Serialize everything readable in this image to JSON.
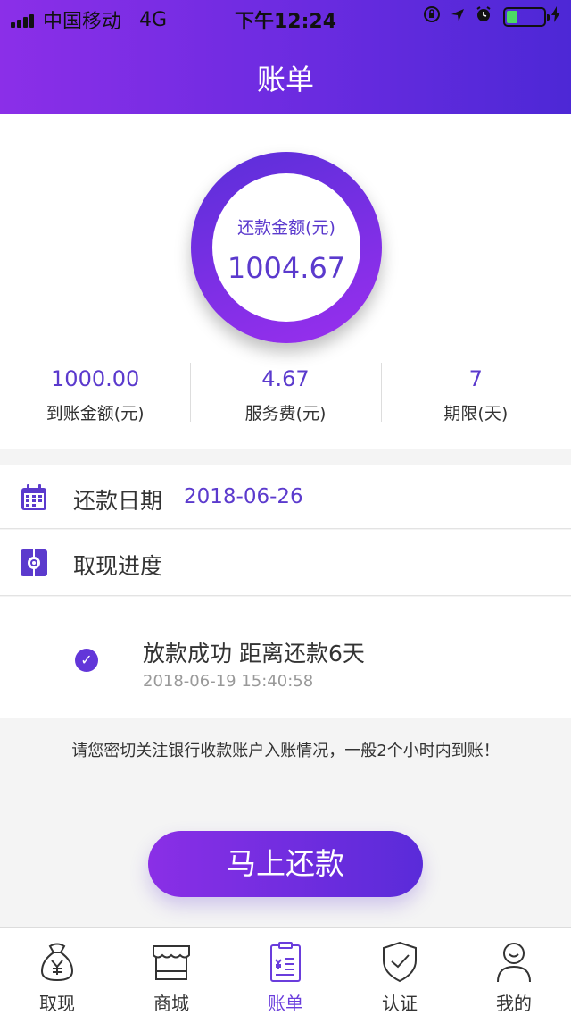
{
  "status_bar": {
    "carrier": "中国移动",
    "network": "4G",
    "time": "下午12:24"
  },
  "header": {
    "title": "账单"
  },
  "summary": {
    "repay_label": "还款金额(元)",
    "repay_amount": "1004.67",
    "stats": [
      {
        "value": "1000.00",
        "label": "到账金额(元)"
      },
      {
        "value": "4.67",
        "label": "服务费(元)"
      },
      {
        "value": "7",
        "label": "期限(天)"
      }
    ]
  },
  "repay_date": {
    "label": "还款日期",
    "value": "2018-06-26"
  },
  "progress": {
    "label": "取现进度",
    "event_title": "放款成功 距离还款6天",
    "event_time": "2018-06-19 15:40:58"
  },
  "notice": "请您密切关注银行收款账户入账情况，一般2个小时内到账！",
  "cta_label": "马上还款",
  "tabs": [
    {
      "label": "取现",
      "icon": "money-bag-icon"
    },
    {
      "label": "商城",
      "icon": "store-icon"
    },
    {
      "label": "账单",
      "icon": "bill-icon",
      "active": true
    },
    {
      "label": "认证",
      "icon": "shield-check-icon"
    },
    {
      "label": "我的",
      "icon": "user-icon"
    }
  ],
  "colors": {
    "accent": "#6a3ddc",
    "header_start": "#8b2fe8",
    "header_end": "#4d28d6",
    "battery": "#4cd964"
  }
}
